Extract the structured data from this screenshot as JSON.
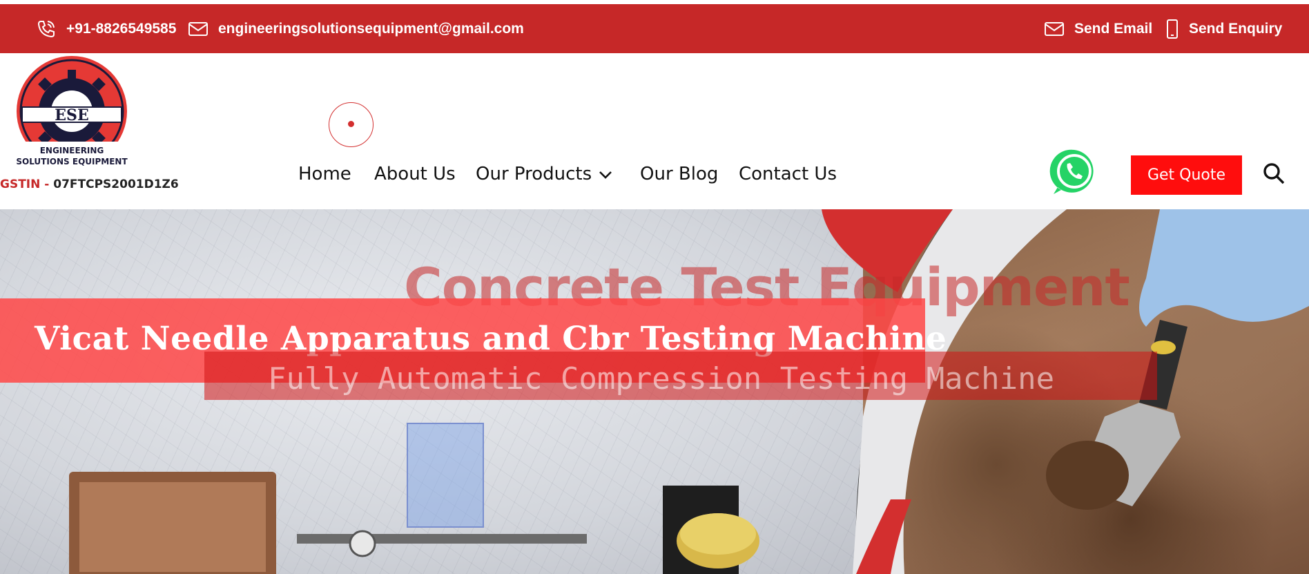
{
  "topbar": {
    "phone": "+91-8826549585",
    "email": "engineeringsolutionsequipment@gmail.com",
    "send_email": "Send Email",
    "send_enquiry": "Send Enquiry",
    "icons": [
      "phone-icon",
      "mail-icon",
      "mobile-icon"
    ],
    "bg_color": "#c62828"
  },
  "logo": {
    "abbr": "ESE",
    "line1": "ENGINEERING",
    "line2": "SOLUTIONS EQUIPMENT"
  },
  "gstin": {
    "label": "GSTIN -",
    "value": "07FTCPS2001D1Z6"
  },
  "nav": {
    "items": [
      "Home",
      "About Us",
      "Our Products",
      "Our Blog",
      "Contact Us"
    ]
  },
  "header": {
    "quote_label": "Get Quote",
    "quote_color": "#ff0d0d",
    "whatsapp_color": "#25d366"
  },
  "hero": {
    "title": "Concrete Test Equipment",
    "band_text": "Vicat Needle Apparatus and Cbr Testing Machine",
    "band2_text": "Fully Automatic Compression Testing Machine"
  }
}
